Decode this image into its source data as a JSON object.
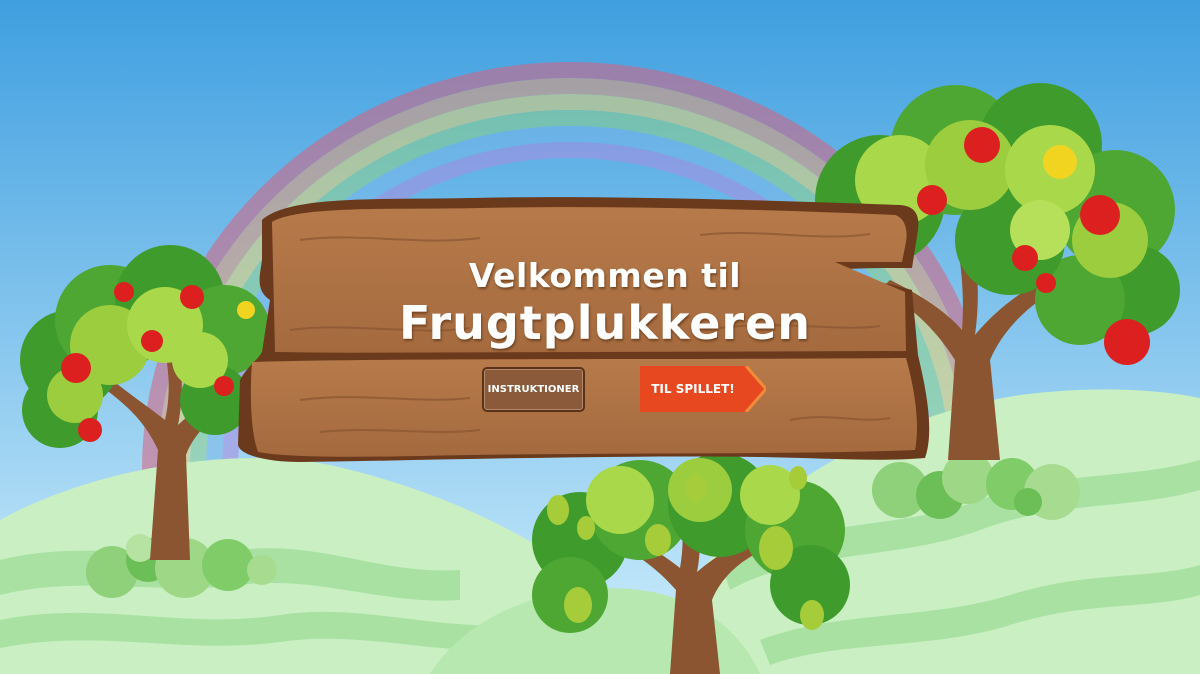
{
  "sign": {
    "welcome": "Velkommen til",
    "title": "Frugtplukkeren"
  },
  "buttons": {
    "instructions_label": "INSTRUKTIONER",
    "play_label": "TIL SPILLET!"
  },
  "colors": {
    "sky": "#5fb3e6",
    "wood": "#a0653c",
    "play_button": "#e8481f",
    "instructions_button": "#8a5a3a"
  }
}
